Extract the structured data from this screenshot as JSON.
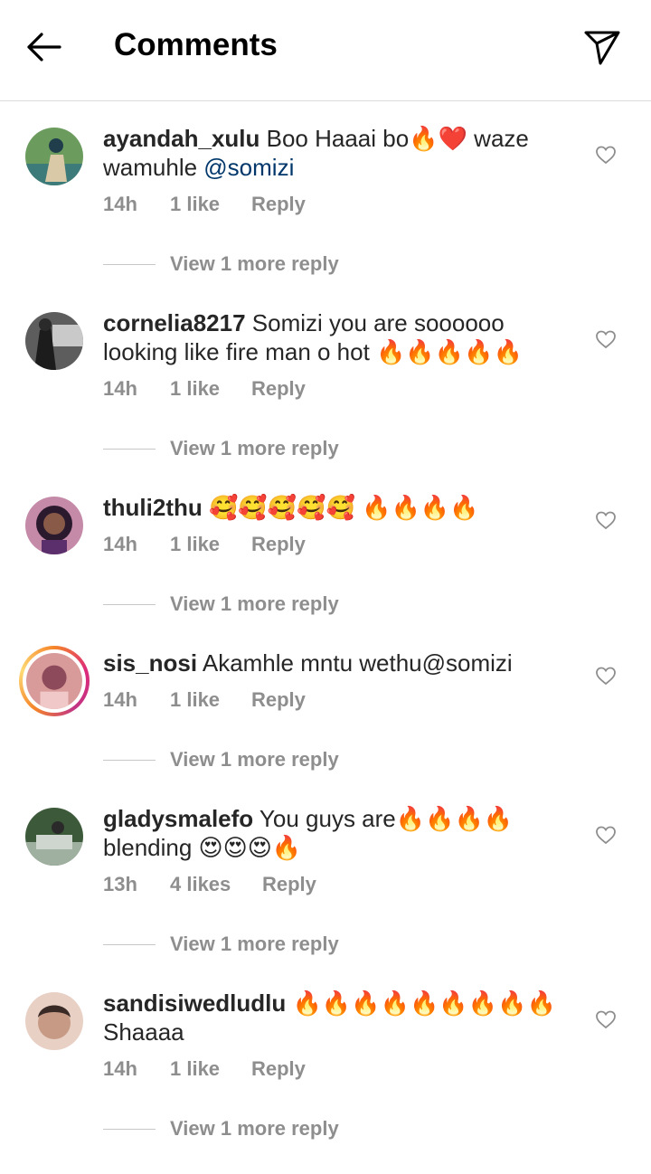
{
  "header": {
    "title": "Comments"
  },
  "comments": [
    {
      "username": "ayandah_xulu",
      "text": " Boo Haaai bo🔥❤️ waze wamuhle ",
      "mention": "@somizi",
      "time": "14h",
      "likes": "1 like",
      "reply": "Reply",
      "more": "View 1 more reply",
      "avatar_colors": [
        "#6b9c5e",
        "#1f3d4a",
        "#d9c9a7"
      ]
    },
    {
      "username": "cornelia8217",
      "text": " Somizi you are soooooo looking like fire man o hot 🔥🔥🔥🔥🔥",
      "time": "14h",
      "likes": "1 like",
      "reply": "Reply",
      "more": "View 1 more reply",
      "avatar_colors": [
        "#2a2a2a",
        "#9b9b9b",
        "#5d5d5d"
      ]
    },
    {
      "username": "thuli2thu",
      "text": " 🥰🥰🥰🥰🥰 🔥🔥🔥🔥",
      "time": "14h",
      "likes": "1 like",
      "reply": "Reply",
      "more": "View 1 more reply",
      "avatar_colors": [
        "#5b2f6b",
        "#c48aa8",
        "#2b1a2e"
      ]
    },
    {
      "username": "sis_nosi",
      "text": " Akamhle mntu wethu@somizi",
      "time": "14h",
      "likes": "1 like",
      "reply": "Reply",
      "more": "View 1 more reply",
      "avatar_colors": [
        "#d99a9a",
        "#8c4a5a",
        "#f0c8c8"
      ]
    },
    {
      "username": "gladysmalefo",
      "text": " You guys are🔥🔥🔥🔥 blending 😍😍😍🔥",
      "time": "13h",
      "likes": "4 likes",
      "reply": "Reply",
      "more": "View 1 more reply",
      "avatar_colors": [
        "#3c5a3a",
        "#9fb0a0",
        "#cfd6d0"
      ]
    },
    {
      "username": "sandisiwedludlu",
      "text": " 🔥🔥🔥🔥🔥🔥🔥🔥🔥 Shaaaa",
      "time": "14h",
      "likes": "1 like",
      "reply": "Reply",
      "more": "View 1 more reply",
      "avatar_colors": [
        "#c79a86",
        "#3a2a26",
        "#e8d0c4"
      ]
    }
  ]
}
